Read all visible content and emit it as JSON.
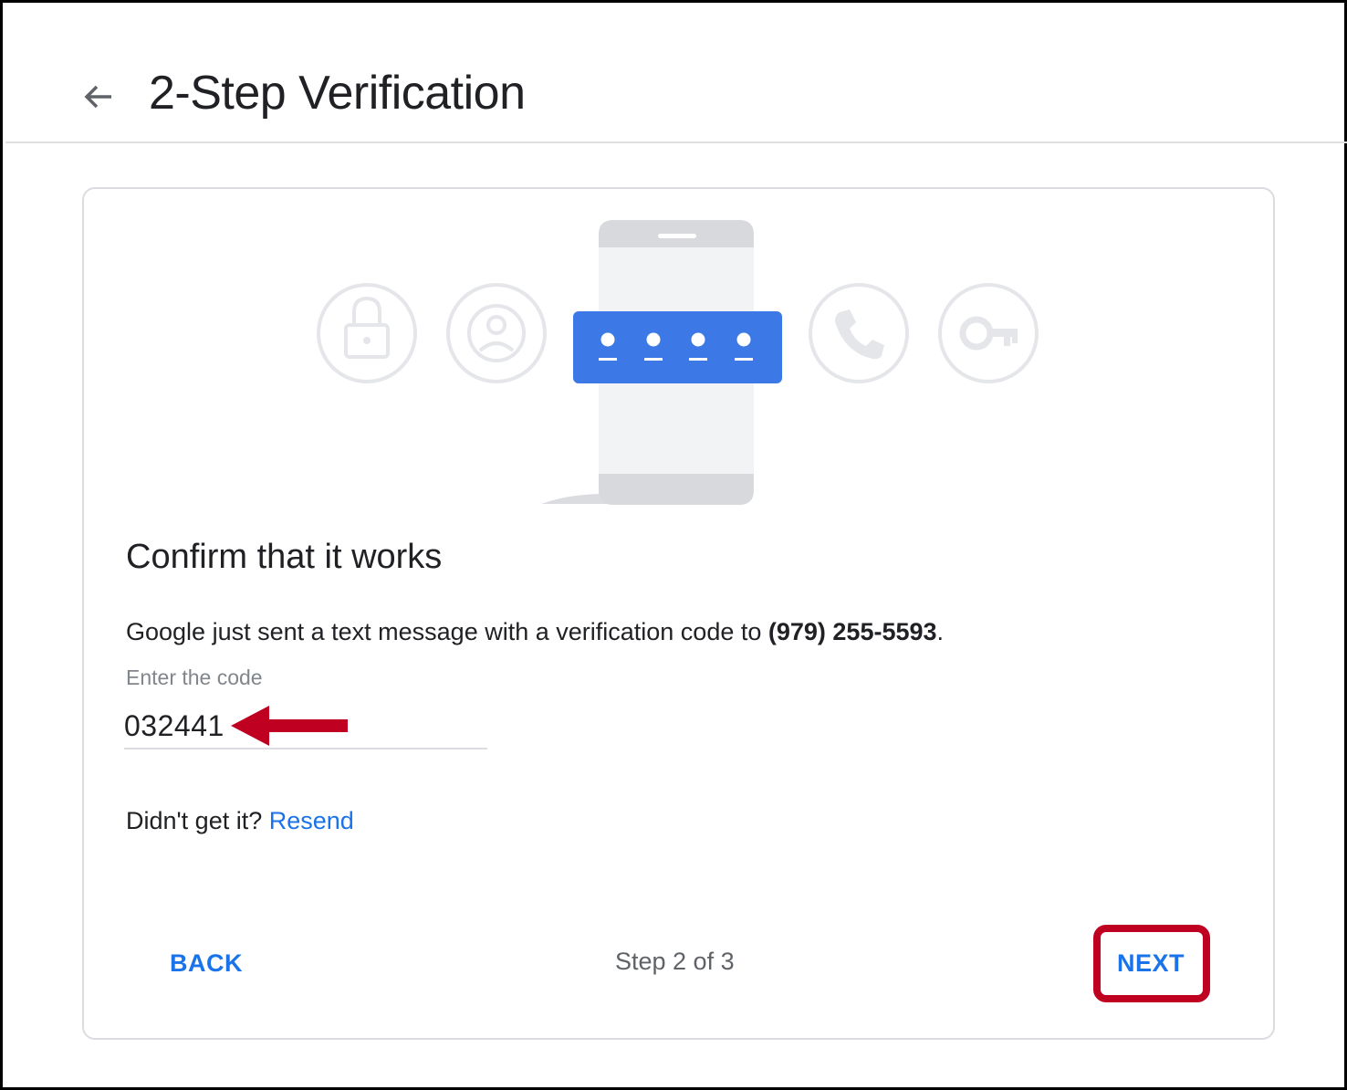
{
  "header": {
    "title": "2-Step Verification",
    "back_icon": "arrow-left-icon"
  },
  "illustration": {
    "icons": [
      "lock-icon",
      "account-circle-icon",
      "phone-call-icon",
      "key-icon"
    ],
    "center_icon": "phone-with-code-icon",
    "accent_color": "#3c79e6"
  },
  "card": {
    "heading": "Confirm that it works",
    "message_prefix": "Google just sent a text message with a verification code to ",
    "phone_number": "(979) 255-5593",
    "message_suffix": ".",
    "code_label": "Enter the code",
    "code_value": "032441",
    "resend_prompt": "Didn't get it? ",
    "resend_label": "Resend",
    "back_label": "BACK",
    "step_text": "Step 2 of 3",
    "next_label": "NEXT"
  },
  "annotations": {
    "arrow_color": "#c00020",
    "highlight_color": "#c00020"
  }
}
